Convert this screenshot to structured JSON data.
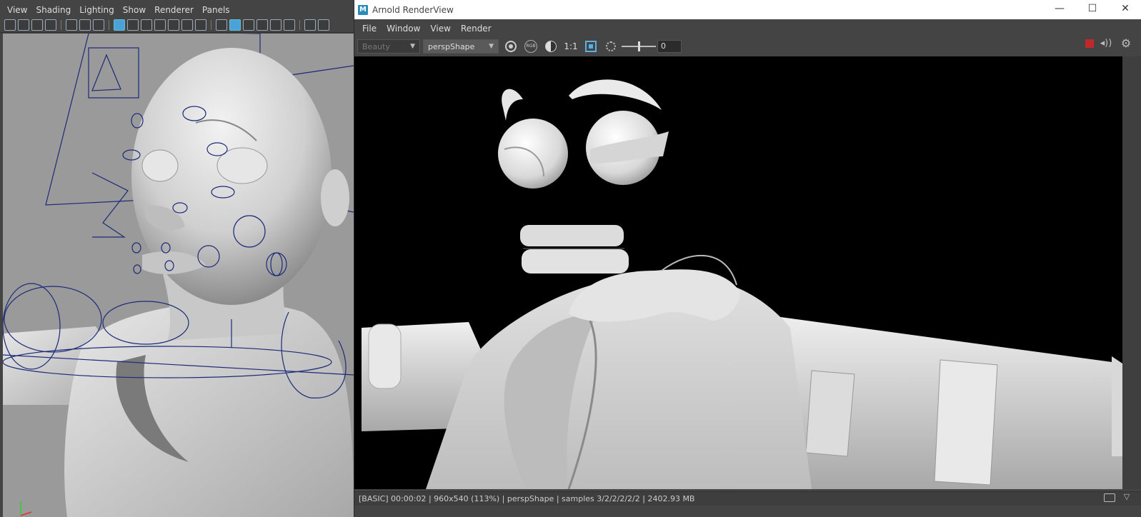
{
  "viewport": {
    "menu": [
      "View",
      "Shading",
      "Lighting",
      "Show",
      "Renderer",
      "Panels"
    ]
  },
  "arnold": {
    "title": "Arnold RenderView",
    "app_icon_letter": "M",
    "menu": [
      "File",
      "Window",
      "View",
      "Render"
    ],
    "toolbar": {
      "aov": "Beauty",
      "camera": "perspShape",
      "rgb_label": "RGB",
      "ratio": "1:1",
      "exposure_value": "0",
      "exposure_level": 0.5
    },
    "status": "[BASIC]   00:00:02 | 960x540 (113%) | perspShape  | samples 3/2/2/2/2/2 | 2402.93 MB",
    "window_controls": {
      "minimize": "—",
      "maximize": "☐",
      "close": "✕"
    }
  }
}
